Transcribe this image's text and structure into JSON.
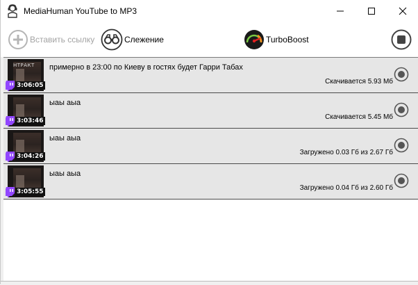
{
  "window": {
    "title": "MediaHuman YouTube to MP3"
  },
  "toolbar": {
    "paste_label": "Вставить ссылку",
    "tracking_label": "Слежение",
    "turbo_label": "TurboBoost"
  },
  "downloads": [
    {
      "title": "примерно в 23:00 по Киеву в гостях будет Гарри Табах",
      "status": "Скачивается 5.93 Мб",
      "duration": "3:06:05",
      "thumb_caption": "НТРАКТ"
    },
    {
      "title": "ыаы аыа",
      "status": "Скачивается 5.45 Мб",
      "duration": "3:03:46",
      "thumb_caption": ""
    },
    {
      "title": "ыаы аыа",
      "status": "Загружено 0.03 Гб из 2.67 Гб",
      "duration": "3:04:26",
      "thumb_caption": ""
    },
    {
      "title": "ыаы аыа",
      "status": "Загружено 0.04 Гб из 2.60 Гб",
      "duration": "3:05:55",
      "thumb_caption": ""
    }
  ],
  "colors": {
    "row_bg": "#e6e6e6",
    "twitch_purple": "#9146ff",
    "turbo_red": "#e02020"
  }
}
